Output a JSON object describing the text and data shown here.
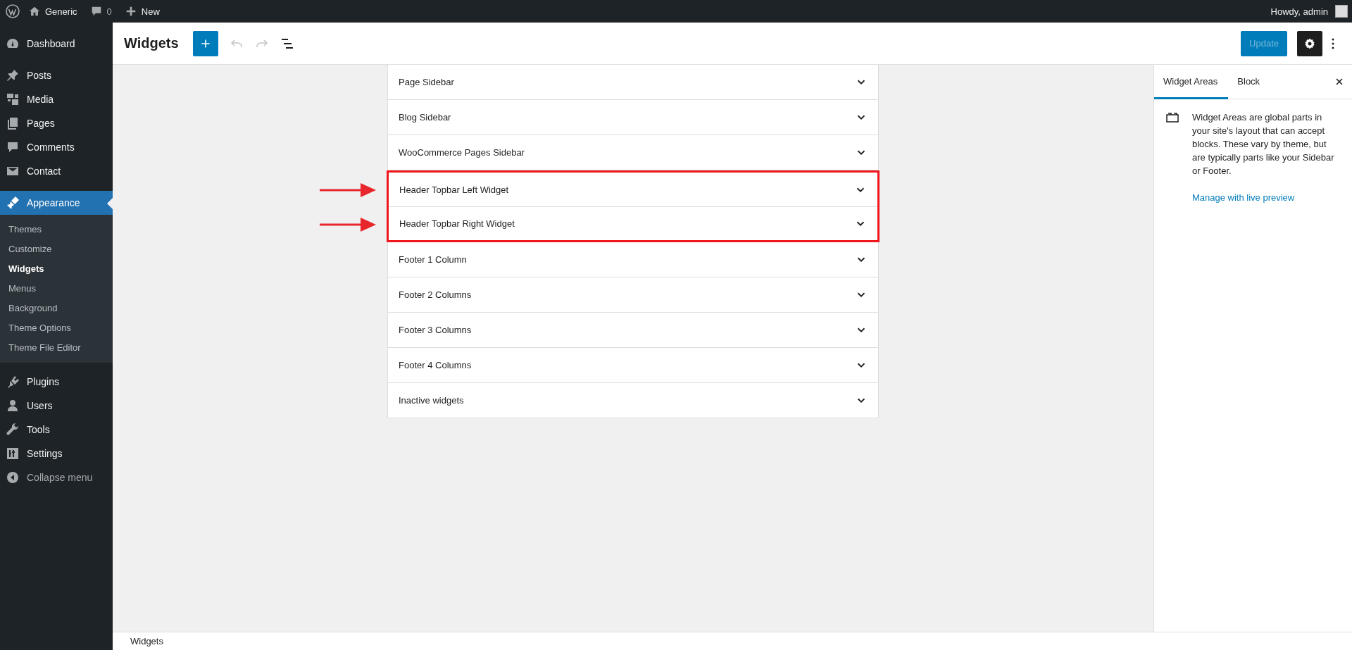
{
  "admin_bar": {
    "site": "Generic",
    "comments": "0",
    "new": "New",
    "greeting": "Howdy, admin"
  },
  "sidebar": {
    "items": [
      {
        "label": "Dashboard",
        "selected": false
      },
      {
        "label": "Posts",
        "selected": false
      },
      {
        "label": "Media",
        "selected": false
      },
      {
        "label": "Pages",
        "selected": false
      },
      {
        "label": "Comments",
        "selected": false
      },
      {
        "label": "Contact",
        "selected": false
      },
      {
        "label": "Appearance",
        "selected": true,
        "children": [
          {
            "label": "Themes",
            "selected": false
          },
          {
            "label": "Customize",
            "selected": false
          },
          {
            "label": "Widgets",
            "selected": true
          },
          {
            "label": "Menus",
            "selected": false
          },
          {
            "label": "Background",
            "selected": false
          },
          {
            "label": "Theme Options",
            "selected": false
          },
          {
            "label": "Theme File Editor",
            "selected": false
          }
        ]
      },
      {
        "label": "Plugins",
        "selected": false
      },
      {
        "label": "Users",
        "selected": false
      },
      {
        "label": "Tools",
        "selected": false
      },
      {
        "label": "Settings",
        "selected": false
      }
    ],
    "collapse": "Collapse menu"
  },
  "header": {
    "title": "Widgets",
    "update_button": {
      "label": "Update",
      "disabled": true
    }
  },
  "widget_areas": [
    {
      "label": "Page Sidebar",
      "highlighted": false
    },
    {
      "label": "Blog Sidebar",
      "highlighted": false
    },
    {
      "label": "WooCommerce Pages Sidebar",
      "highlighted": false
    },
    {
      "label": "Header Topbar Left Widget",
      "highlighted": true
    },
    {
      "label": "Header Topbar Right Widget",
      "highlighted": true
    },
    {
      "label": "Footer 1 Column",
      "highlighted": false
    },
    {
      "label": "Footer 2 Columns",
      "highlighted": false
    },
    {
      "label": "Footer 3 Columns",
      "highlighted": false
    },
    {
      "label": "Footer 4 Columns",
      "highlighted": false
    },
    {
      "label": "Inactive widgets",
      "highlighted": false
    }
  ],
  "inspector": {
    "tabs": [
      {
        "label": "Widget Areas",
        "selected": true
      },
      {
        "label": "Block",
        "selected": false
      }
    ],
    "description": "Widget Areas are global parts in your site's layout that can accept blocks. These vary by theme, but are typically parts like your Sidebar or Footer.",
    "link": "Manage with live preview"
  },
  "footer": {
    "breadcrumb": "Widgets"
  }
}
